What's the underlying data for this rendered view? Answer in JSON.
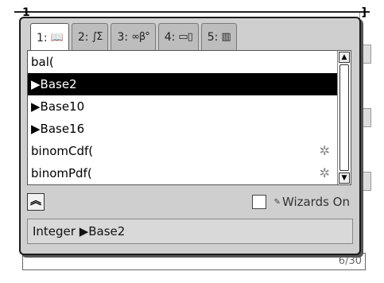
{
  "background": {
    "left_glyph": "1̲",
    "right_glyph": "]",
    "entry_text": "6/30"
  },
  "catalog": {
    "tabs": [
      {
        "num": "1:",
        "icon": "📖",
        "icon_name": "book-icon",
        "active": true
      },
      {
        "num": "2:",
        "icon": "∫Σ",
        "icon_name": "integral-sum-icon",
        "active": false
      },
      {
        "num": "3:",
        "icon": "∞β°",
        "icon_name": "symbols-icon",
        "active": false
      },
      {
        "num": "4:",
        "icon": "▭▯",
        "icon_name": "templates-icon",
        "active": false
      },
      {
        "num": "5:",
        "icon": "▥",
        "icon_name": "library-icon",
        "active": false
      }
    ],
    "items": [
      {
        "label": "bal(",
        "selected": false,
        "wizard": false
      },
      {
        "label": "▶Base2",
        "selected": true,
        "wizard": false
      },
      {
        "label": "▶Base10",
        "selected": false,
        "wizard": false
      },
      {
        "label": "▶Base16",
        "selected": false,
        "wizard": false
      },
      {
        "label": "binomCdf(",
        "selected": false,
        "wizard": true
      },
      {
        "label": "binomPdf(",
        "selected": false,
        "wizard": true
      }
    ],
    "wizard_glyph": "✲",
    "scroll_up": "▲",
    "scroll_down": "▼",
    "collapse_glyph": "︽",
    "wizards_label": "Wizards On",
    "wizards_mini": "✎",
    "wizards_checked": false,
    "help_text": "Integer ▶Base2"
  }
}
